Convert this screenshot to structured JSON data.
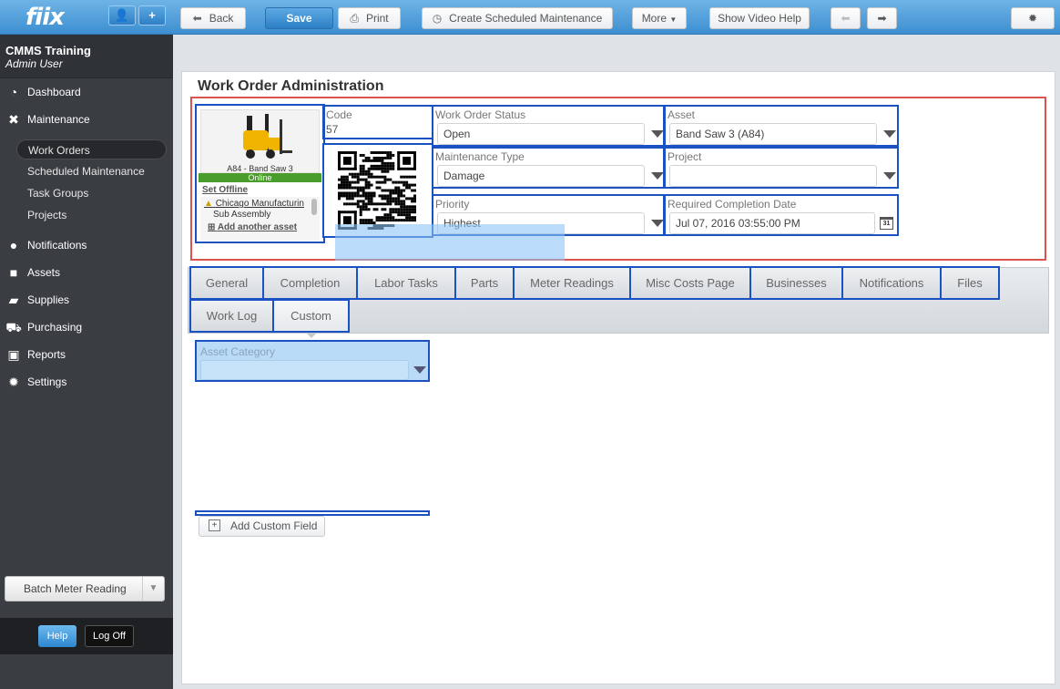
{
  "app": {
    "logo": "fiix",
    "user_btn_icon": "👤",
    "add_btn_icon": "+"
  },
  "user": {
    "org": "CMMS Training",
    "role": "Admin User"
  },
  "nav": {
    "dashboard": "Dashboard",
    "maintenance": "Maintenance",
    "work_orders": "Work Orders",
    "scheduled_maintenance": "Scheduled Maintenance",
    "task_groups": "Task Groups",
    "projects": "Projects",
    "notifications": "Notifications",
    "assets": "Assets",
    "supplies": "Supplies",
    "purchasing": "Purchasing",
    "reports": "Reports",
    "settings": "Settings"
  },
  "sidebar_bottom": {
    "batch_meter": "Batch Meter Reading",
    "help": "Help",
    "logoff": "Log Off"
  },
  "toolbar": {
    "back": "Back",
    "save": "Save",
    "print": "Print",
    "create_sm": "Create Scheduled Maintenance",
    "more": "More",
    "video_help": "Show Video Help"
  },
  "page": {
    "title": "Work Order Administration"
  },
  "asset_card": {
    "name": "A84 - Band Saw 3",
    "status": "Online",
    "set_offline": "Set Offline",
    "location": "Chicago Manufacturin",
    "sub": "Sub Assembly",
    "add_another": "Add another asset"
  },
  "form": {
    "code_label": "Code",
    "code_value": "57",
    "status_label": "Work Order Status",
    "status_value": "Open",
    "asset_label": "Asset",
    "asset_value": "Band Saw 3 (A84)",
    "mtype_label": "Maintenance Type",
    "mtype_value": "Damage",
    "project_label": "Project",
    "project_value": "",
    "priority_label": "Priority",
    "priority_value": "Highest",
    "rcd_label": "Required Completion Date",
    "rcd_value": "Jul 07, 2016 03:55:00 PM",
    "calendar_day": "31"
  },
  "tabs": [
    "General",
    "Completion",
    "Labor Tasks",
    "Parts",
    "Meter Readings",
    "Misc Costs Page",
    "Businesses",
    "Notifications",
    "Files",
    "Work Log",
    "Custom"
  ],
  "custom": {
    "asset_category_label": "Asset Category",
    "add_custom_field": "Add Custom Field"
  }
}
